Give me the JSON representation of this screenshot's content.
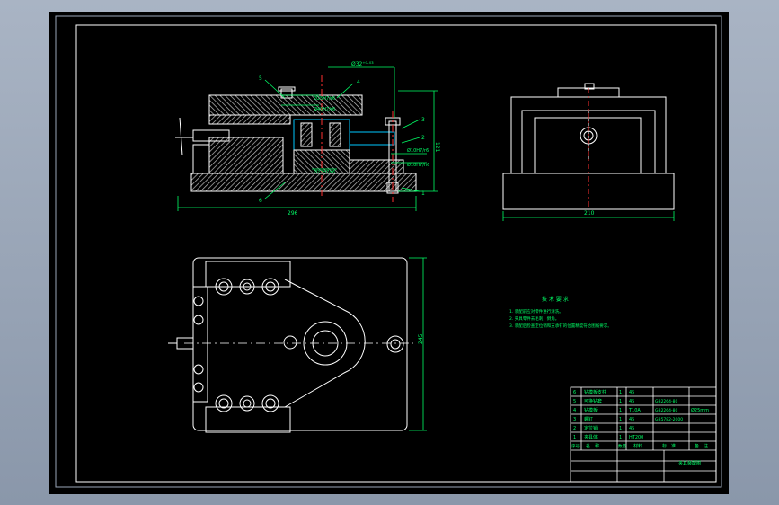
{
  "colors": {
    "background": "#000000",
    "outline": "#ffffff",
    "dimension": "#00ff66",
    "hatch": "#c8c8c8",
    "center": "#ff3030",
    "highlight": "#00c8ff",
    "outer": "#9aa6b8"
  },
  "front_view": {
    "callouts": [
      "5",
      "4",
      "3",
      "2",
      "1",
      "6"
    ],
    "dims": {
      "top": "Ø32⁺⁰·⁰³",
      "width": "296",
      "height": "121"
    },
    "fits": [
      "Ø25H7/r6",
      "Ø40H7/r6",
      "Ø22H7/r6",
      "Ø10H7/r6",
      "Ø10H7/h6",
      "Ø40H7/r6"
    ]
  },
  "side_view": {
    "dims": {
      "width": "210"
    }
  },
  "top_view": {
    "dims": {
      "height": "245"
    }
  },
  "tech_req": {
    "title": "技 术 要 求",
    "items": [
      "1. 装配前应对零件进行清洗。",
      "2. 夹具零件去毛刺，倒角。",
      "3. 装配后检查定位销和支承钉的位置精度符合图纸要求。"
    ]
  },
  "bom": {
    "rows": [
      {
        "no": "6",
        "name": "钻模板支柱",
        "qty": "1",
        "material": "45",
        "std": "",
        "note": ""
      },
      {
        "no": "5",
        "name": "可换钻套",
        "qty": "1",
        "material": "45",
        "std": "GB2264-80",
        "note": ""
      },
      {
        "no": "4",
        "name": "钻模板",
        "qty": "1",
        "material": "T10A",
        "std": "GB2264-80",
        "note": "Ø25mm"
      },
      {
        "no": "3",
        "name": "螺钉",
        "qty": "1",
        "material": "45",
        "std": "GB5782-2000",
        "note": ""
      },
      {
        "no": "2",
        "name": "定位销",
        "qty": "1",
        "material": "45",
        "std": "",
        "note": ""
      },
      {
        "no": "1",
        "name": "夹具体",
        "qty": "1",
        "material": "HT200",
        "std": "",
        "note": ""
      }
    ],
    "header": [
      "序号",
      "名　称",
      "数量",
      "材料",
      "标　准",
      "备　注"
    ],
    "drawing_name": "夹具装配图"
  }
}
